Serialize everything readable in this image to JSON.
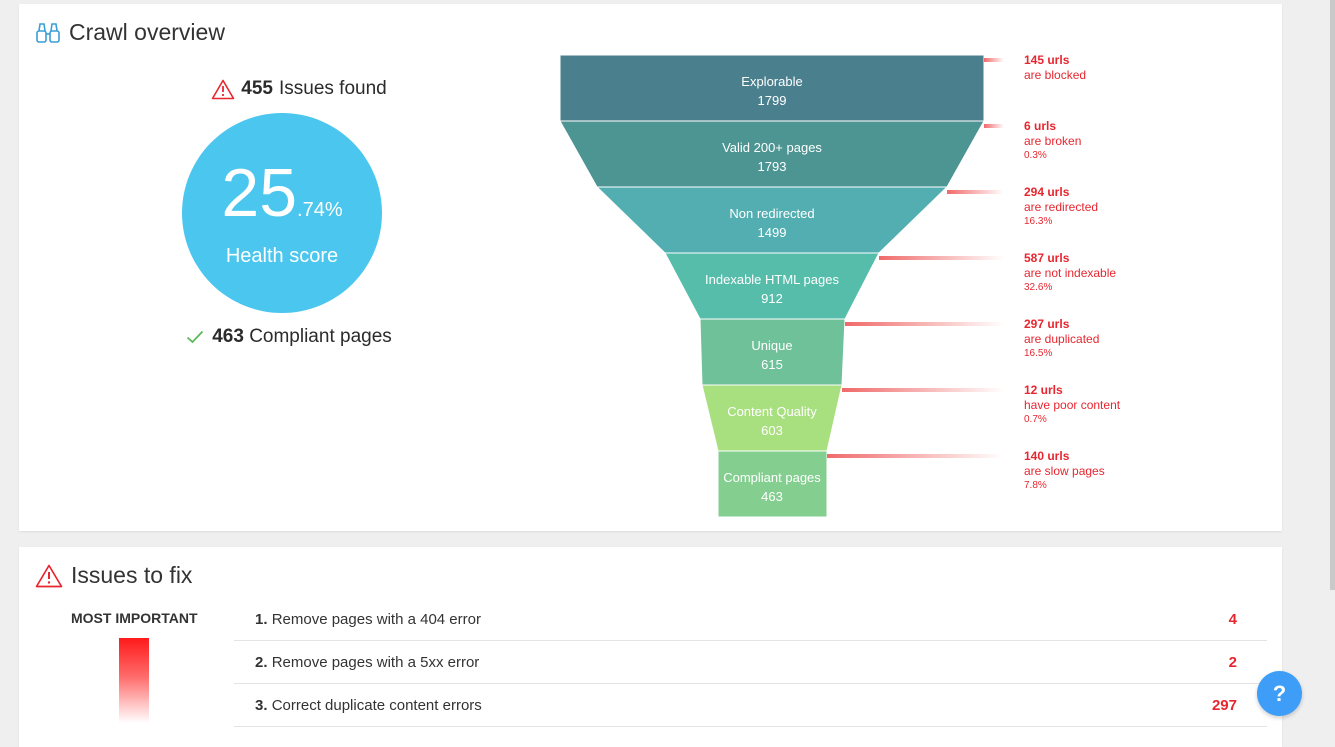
{
  "overview": {
    "title": "Crawl overview",
    "issues_count": "455",
    "issues_label": "Issues found",
    "score_int": "25",
    "score_dec": ".74%",
    "score_label": "Health score",
    "compliant_count": "463",
    "compliant_label": "Compliant pages"
  },
  "funnel": {
    "stages": [
      {
        "name": "Explorable",
        "value": "1799",
        "color": "#4a808e"
      },
      {
        "name": "Valid 200+ pages",
        "value": "1793",
        "color": "#4c9593"
      },
      {
        "name": "Non redirected",
        "value": "1499",
        "color": "#53aeb1"
      },
      {
        "name": "Indexable HTML pages",
        "value": "912",
        "color": "#55bda9"
      },
      {
        "name": "Unique",
        "value": "615",
        "color": "#6fc19a"
      },
      {
        "name": "Content Quality",
        "value": "603",
        "color": "#a9e07f"
      },
      {
        "name": "Compliant pages",
        "value": "463",
        "color": "#84cf90"
      }
    ],
    "losses": [
      {
        "count": "145 urls",
        "label": "are blocked",
        "pct": ""
      },
      {
        "count": "6 urls",
        "label": "are broken",
        "pct": "0.3%"
      },
      {
        "count": "294 urls",
        "label": "are redirected",
        "pct": "16.3%"
      },
      {
        "count": "587 urls",
        "label": "are not indexable",
        "pct": "32.6%"
      },
      {
        "count": "297 urls",
        "label": "are duplicated",
        "pct": "16.5%"
      },
      {
        "count": "12 urls",
        "label": "have poor content",
        "pct": "0.7%"
      },
      {
        "count": "140 urls",
        "label": "are slow pages",
        "pct": "7.8%"
      }
    ]
  },
  "issues": {
    "title": "Issues to fix",
    "priority_label": "MOST IMPORTANT",
    "rows": [
      {
        "num": "1.",
        "text": "Remove pages with a 404 error",
        "count": "4"
      },
      {
        "num": "2.",
        "text": "Remove pages with a 5xx error",
        "count": "2"
      },
      {
        "num": "3.",
        "text": "Correct duplicate content errors",
        "count": "297"
      }
    ]
  },
  "help": {
    "label": "?"
  },
  "colors": {
    "accent": "#4bc6ee",
    "error": "#e8262f",
    "help": "#3e9ef7"
  }
}
